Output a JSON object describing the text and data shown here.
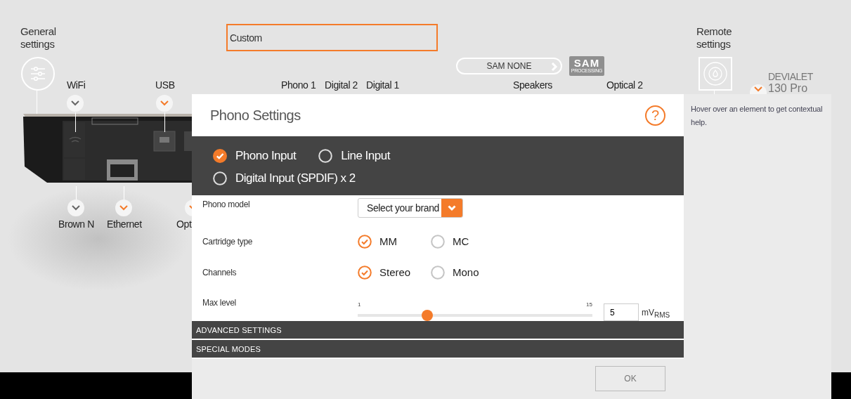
{
  "general_settings": {
    "label": "General settings"
  },
  "preset_field": {
    "value": "Custom"
  },
  "sam_button": {
    "label": "SAM NONE"
  },
  "sam_logo": {
    "title": "SAM",
    "subtitle": "PROCESSING"
  },
  "top_ports": [
    {
      "label": "WiFi",
      "highlighted": false
    },
    {
      "label": "USB",
      "highlighted": true
    }
  ],
  "top_labels": [
    "Phono 1",
    "Digital 2",
    "Digital 1",
    "Speakers",
    "Optical 2"
  ],
  "bottom_ports": [
    {
      "label": "Brown N",
      "highlighted": false
    },
    {
      "label": "Ethernet",
      "highlighted": true
    },
    {
      "label": "Opt",
      "highlighted": true
    }
  ],
  "remote_settings": {
    "label": "Remote settings"
  },
  "device": {
    "brand": "DEVIALET",
    "model": "130 Pro",
    "highlighted": true
  },
  "dialog": {
    "title": "Phono Settings",
    "help": "?",
    "input_modes": [
      {
        "label": "Phono Input",
        "selected": true
      },
      {
        "label": "Line Input",
        "selected": false
      },
      {
        "label": "Digital Input (SPDIF) x 2",
        "selected": false
      }
    ],
    "phono_model": {
      "label": "Phono model",
      "placeholder": "Select your brand"
    },
    "cartridge_type": {
      "label": "Cartridge type",
      "options": [
        {
          "label": "MM",
          "selected": true
        },
        {
          "label": "MC",
          "selected": false
        }
      ]
    },
    "channels": {
      "label": "Channels",
      "options": [
        {
          "label": "Stereo",
          "selected": true
        },
        {
          "label": "Mono",
          "selected": false
        }
      ]
    },
    "max_level": {
      "label": "Max level",
      "min": "1",
      "max": "15",
      "level": 0.286,
      "value": "5",
      "unit": "mV$_{RMS}$"
    },
    "sections": [
      "ADVANCED SETTINGS",
      "SPECIAL MODES"
    ],
    "ok": "OK"
  },
  "help_panel": {
    "text": "Hover over an element to get contextual help."
  }
}
